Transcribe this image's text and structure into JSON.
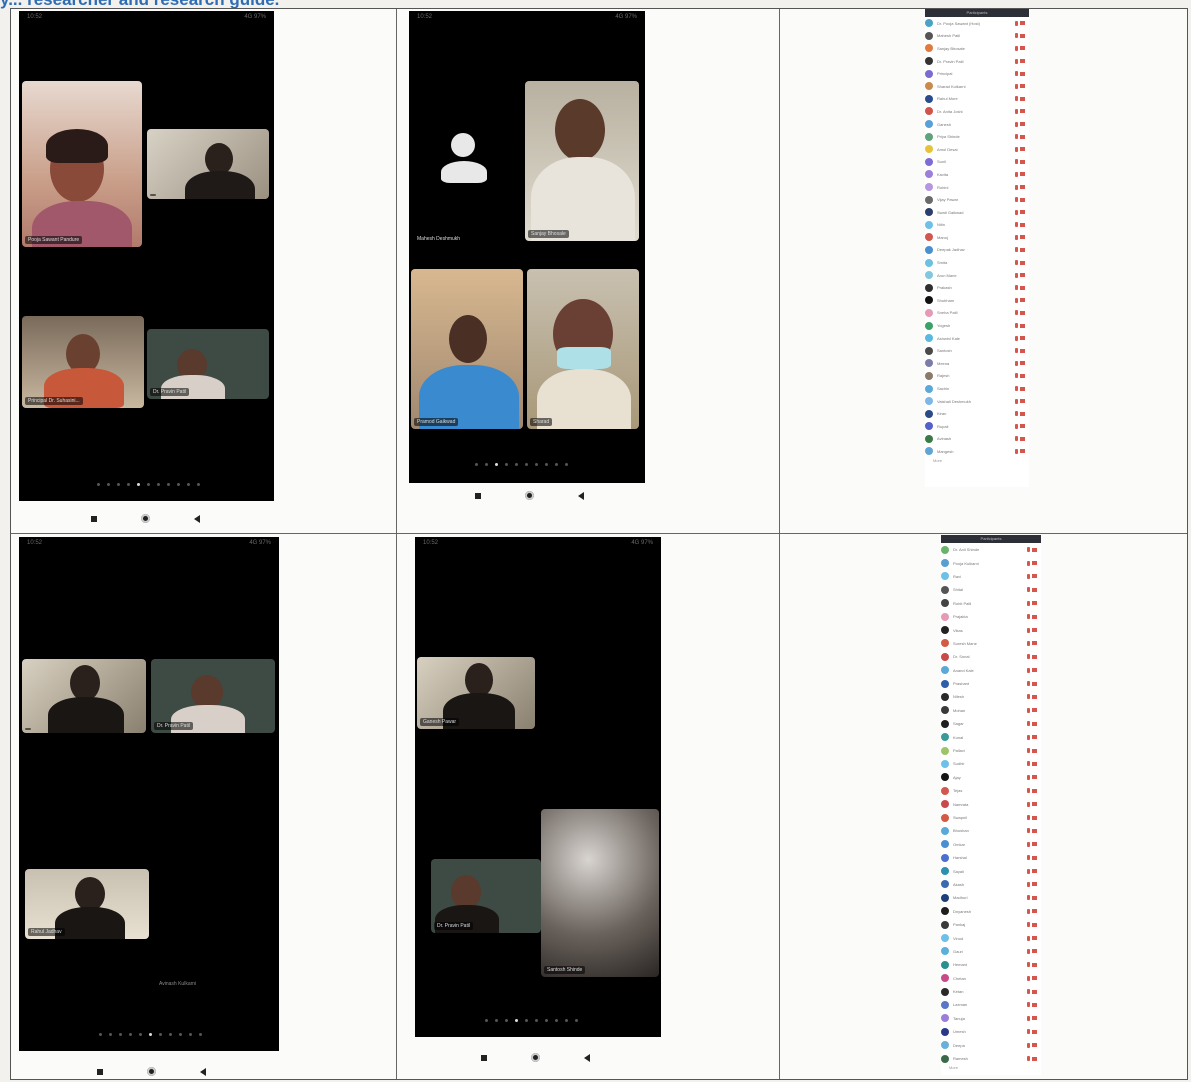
{
  "document": {
    "heading": "y... researcher and research guide.",
    "phone_status": {
      "left": "10:52",
      "right": "4G  97%"
    }
  },
  "screenshots": {
    "s1": {
      "tiles": [
        {
          "name": "Pooja Sawant Pandure"
        },
        {
          "name": ""
        },
        {
          "name": "Principal Dr. Suhasini..."
        },
        {
          "name": "Dr. Pravin Patil"
        }
      ]
    },
    "s2": {
      "tiles": [
        {
          "name": "Mahesh Deshmukh"
        },
        {
          "name": "Sanjay Bhosale"
        },
        {
          "name": "Pramod Gaikwad"
        },
        {
          "name": "Sharad"
        }
      ]
    },
    "s4": {
      "tiles": [
        {
          "name": ""
        },
        {
          "name": "Dr. Pravin Patil"
        },
        {
          "name": "Rahul Jadhav"
        }
      ],
      "float_label": "Avinash Kulkarni"
    },
    "s5": {
      "tiles": [
        {
          "name": "Ganesh Pawar"
        },
        {
          "name": "Dr. Pravin Patil"
        },
        {
          "name": "Santosh Shinde"
        }
      ]
    }
  },
  "participants": {
    "list1_title": "Participants",
    "list2_title": "Participants",
    "list1_footer": "More",
    "list2_footer": "More",
    "list1": [
      {
        "name": "Dr. Pooja Sawant (Host)",
        "color": "#4aa3c7"
      },
      {
        "name": "Mahesh Patil",
        "color": "#555555"
      },
      {
        "name": "Sanjay Bhosale",
        "color": "#e07a3e"
      },
      {
        "name": "Dr. Pravin Patil",
        "color": "#333333"
      },
      {
        "name": "Principal",
        "color": "#7a6bd0"
      },
      {
        "name": "Sharad Kulkarni",
        "color": "#c98b4c"
      },
      {
        "name": "Rahul More",
        "color": "#2a4b8d"
      },
      {
        "name": "Dr. Anita Joshi",
        "color": "#d0544a"
      },
      {
        "name": "Ganesh",
        "color": "#5aa0d6"
      },
      {
        "name": "Priya Shinde",
        "color": "#5fa37a"
      },
      {
        "name": "Amol Desai",
        "color": "#e7c23b"
      },
      {
        "name": "Sunil",
        "color": "#7f6bd6"
      },
      {
        "name": "Kavita",
        "color": "#9b7fd8"
      },
      {
        "name": "Rohini",
        "color": "#b597e0"
      },
      {
        "name": "Vijay Pawar",
        "color": "#6a6a6a"
      },
      {
        "name": "Swati Gaikwad",
        "color": "#2a3f6b"
      },
      {
        "name": "Nitin",
        "color": "#6ec0e8"
      },
      {
        "name": "Manoj",
        "color": "#d2574f"
      },
      {
        "name": "Deepak Jadhav",
        "color": "#4a8fd0"
      },
      {
        "name": "Smita",
        "color": "#6cc0e0"
      },
      {
        "name": "Arun Mane",
        "color": "#80c7df"
      },
      {
        "name": "Prakash",
        "color": "#2f2f2f"
      },
      {
        "name": "Shubham",
        "color": "#111111"
      },
      {
        "name": "Sneha Patil",
        "color": "#e59ab7"
      },
      {
        "name": "Yogesh",
        "color": "#3aa169"
      },
      {
        "name": "Ashwini Kale",
        "color": "#5ab9e0"
      },
      {
        "name": "Santosh",
        "color": "#4a4a4a"
      },
      {
        "name": "Meena",
        "color": "#7c7ca8"
      },
      {
        "name": "Rajesh",
        "color": "#8a7a6a"
      },
      {
        "name": "Sachin",
        "color": "#5aa9d9"
      },
      {
        "name": "Vaishali Deshmukh",
        "color": "#7fb8e6"
      },
      {
        "name": "Kiran",
        "color": "#2c4a88"
      },
      {
        "name": "Rupali",
        "color": "#5560c8"
      },
      {
        "name": "Avinash",
        "color": "#3a7a46"
      },
      {
        "name": "Mangesh",
        "color": "#5ea5d6"
      }
    ],
    "list2": [
      {
        "name": "Dr. Anil Shinde",
        "color": "#6bb36b"
      },
      {
        "name": "Pooja Kulkarni",
        "color": "#5a9fd0"
      },
      {
        "name": "Ravi",
        "color": "#6ec0e8"
      },
      {
        "name": "Shital",
        "color": "#555555"
      },
      {
        "name": "Rohit Patil",
        "color": "#444444"
      },
      {
        "name": "Prajakta",
        "color": "#e59ab7"
      },
      {
        "name": "Vikas",
        "color": "#222222"
      },
      {
        "name": "Suresh Mane",
        "color": "#d35a45"
      },
      {
        "name": "Dr. Sonal",
        "color": "#c94a4a"
      },
      {
        "name": "Anand Kale",
        "color": "#5aa9d9"
      },
      {
        "name": "Prashant",
        "color": "#2f5fa8"
      },
      {
        "name": "Nilesh",
        "color": "#2a2a2a"
      },
      {
        "name": "Mohan",
        "color": "#3a3a3a"
      },
      {
        "name": "Sagar",
        "color": "#1f1f1f"
      },
      {
        "name": "Kunal",
        "color": "#3a9a9a"
      },
      {
        "name": "Pallavi",
        "color": "#9ec46a"
      },
      {
        "name": "Sudhir",
        "color": "#6ec0e8"
      },
      {
        "name": "Ajay",
        "color": "#151515"
      },
      {
        "name": "Tejas",
        "color": "#d2574f"
      },
      {
        "name": "Namrata",
        "color": "#c94a4a"
      },
      {
        "name": "Swapnil",
        "color": "#d35a45"
      },
      {
        "name": "Bhushan",
        "color": "#5aa9d9"
      },
      {
        "name": "Omkar",
        "color": "#4a90d0"
      },
      {
        "name": "Harshal",
        "color": "#4a6fd0"
      },
      {
        "name": "Sayali",
        "color": "#2f8fb0"
      },
      {
        "name": "Akash",
        "color": "#3a6ab0"
      },
      {
        "name": "Madhuri",
        "color": "#1f3f7a"
      },
      {
        "name": "Dnyanesh",
        "color": "#1f1f1f"
      },
      {
        "name": "Pankaj",
        "color": "#3a3a3a"
      },
      {
        "name": "Vinod",
        "color": "#6ec0e8"
      },
      {
        "name": "Gauri",
        "color": "#5ab0d9"
      },
      {
        "name": "Hemant",
        "color": "#2a8f8f"
      },
      {
        "name": "Chetan",
        "color": "#c94a8a"
      },
      {
        "name": "Ketan",
        "color": "#2a2a2a"
      },
      {
        "name": "Laxman",
        "color": "#5a78c8"
      },
      {
        "name": "Tanuja",
        "color": "#9a7fd8"
      },
      {
        "name": "Umesh",
        "color": "#2a3a88"
      },
      {
        "name": "Deepa",
        "color": "#6ab0d8"
      },
      {
        "name": "Ramesh",
        "color": "#3a6a4a"
      }
    ]
  }
}
